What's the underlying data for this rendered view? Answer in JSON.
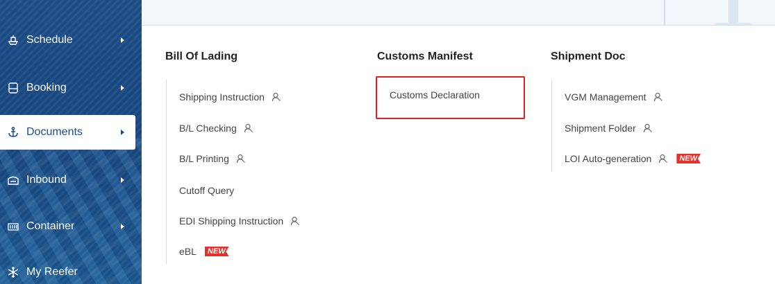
{
  "sidebar": {
    "items": [
      {
        "label": "Schedule",
        "icon": "ship-icon",
        "active": false
      },
      {
        "label": "Booking",
        "icon": "document-icon",
        "active": false
      },
      {
        "label": "Documents",
        "icon": "anchor-icon",
        "active": true
      },
      {
        "label": "Inbound",
        "icon": "house-icon",
        "active": false
      },
      {
        "label": "Container",
        "icon": "container-icon",
        "active": false
      },
      {
        "label": "My Reefer",
        "icon": "snowflake-icon",
        "active": false
      }
    ]
  },
  "menu": {
    "columns": [
      {
        "title": "Bill Of Lading",
        "items": [
          {
            "label": "Shipping Instruction",
            "user_icon": true,
            "new": false
          },
          {
            "label": "B/L Checking",
            "user_icon": true,
            "new": false
          },
          {
            "label": "B/L Printing",
            "user_icon": true,
            "new": false
          },
          {
            "label": "Cutoff Query",
            "user_icon": false,
            "new": false
          },
          {
            "label": "EDI Shipping Instruction",
            "user_icon": true,
            "new": false
          },
          {
            "label": "eBL",
            "user_icon": false,
            "new": true
          }
        ]
      },
      {
        "title": "Customs Manifest",
        "items": [
          {
            "label": "Customs Declaration",
            "user_icon": false,
            "new": false,
            "highlighted": true
          }
        ]
      },
      {
        "title": "Shipment Doc",
        "items": [
          {
            "label": "VGM Management",
            "user_icon": true,
            "new": false
          },
          {
            "label": "Shipment Folder",
            "user_icon": true,
            "new": false
          },
          {
            "label": "LOI Auto-generation",
            "user_icon": true,
            "new": true
          }
        ]
      }
    ],
    "new_badge_label": "NEW"
  },
  "colors": {
    "sidebar_bg": "#1c4d8a",
    "highlight": "#e0201c",
    "badge": "#e5312b"
  }
}
